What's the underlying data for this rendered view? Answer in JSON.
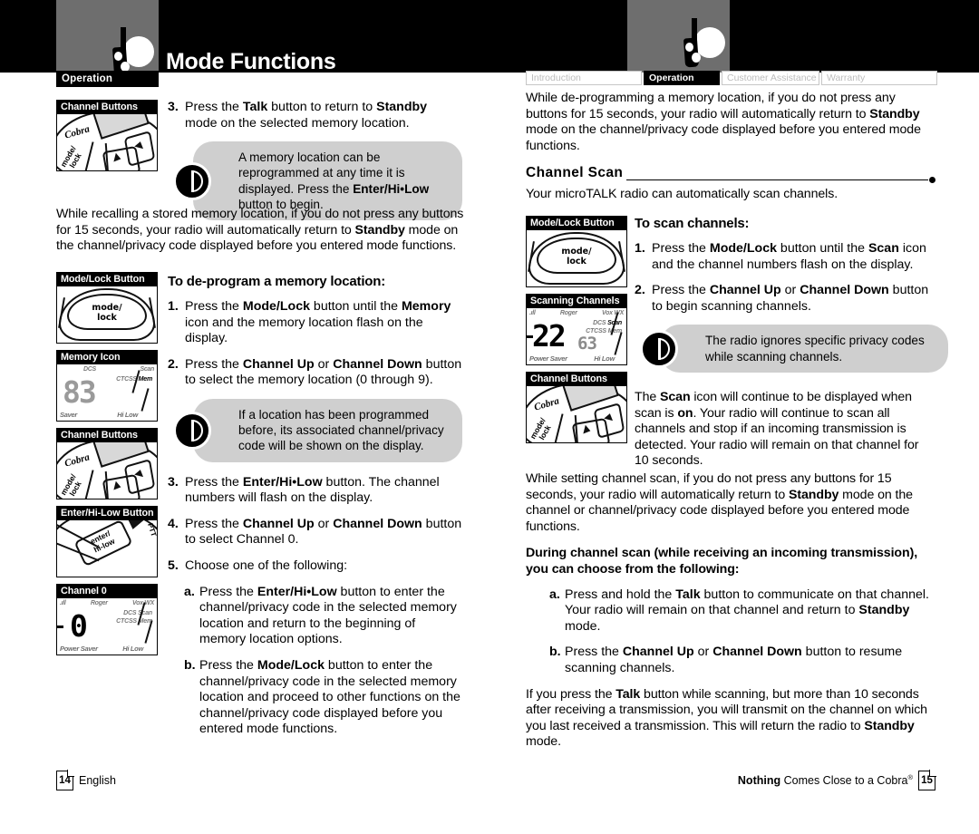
{
  "header": {
    "title": "Mode Functions",
    "section_tab": "Operation",
    "tabs": [
      {
        "label": "Introduction",
        "active": false
      },
      {
        "label": "Operation",
        "active": true
      },
      {
        "label": "Customer Assistance",
        "active": false
      },
      {
        "label": "Warranty",
        "active": false
      }
    ],
    "icon": "radio-walkie-talkie-icon"
  },
  "left_page": {
    "step3": {
      "marker": "3.",
      "text_parts": [
        "Press the ",
        "Talk",
        " button to return to ",
        "Standby",
        " mode on the selected memory location."
      ]
    },
    "tip1": {
      "icon": "info-tip-icon",
      "text_parts": [
        "A memory location can be reprogrammed at any time it is displayed. Press the ",
        "Enter/Hi•Low",
        " button to begin."
      ]
    },
    "paragraph1_parts": [
      "While recalling a stored memory location, if you do not press any buttons for 15 seconds, your radio will automatically return to ",
      "Standby",
      " mode on the channel/privacy code displayed before you entered mode functions."
    ],
    "heading": "To de-program a memory location:",
    "step1": {
      "marker": "1.",
      "parts": [
        "Press the ",
        "Mode/Lock",
        " button until the ",
        "Memory",
        " icon and the memory location flash on the display."
      ]
    },
    "step2": {
      "marker": "2.",
      "parts": [
        "Press the ",
        "Channel Up",
        " or ",
        "Channel Down",
        " button to select the memory location (0 through 9)."
      ]
    },
    "tip2": {
      "icon": "info-tip-icon",
      "text": "If a location has been programmed before, its associated channel/privacy code will be shown on the display."
    },
    "step3b": {
      "marker": "3.",
      "parts": [
        "Press the ",
        "Enter/Hi•Low",
        " button. The channel numbers will flash on the display."
      ]
    },
    "step4": {
      "marker": "4.",
      "parts": [
        "Press the ",
        "Channel Up",
        " or ",
        "Channel Down",
        " button to select Channel 0."
      ]
    },
    "step5": {
      "marker": "5.",
      "text": "Choose one of the following:"
    },
    "step5a": {
      "marker": "a.",
      "parts": [
        "Press the ",
        "Enter/Hi•Low",
        " button to enter the channel/privacy code in the selected memory location and return to the beginning of memory location options."
      ]
    },
    "step5b": {
      "marker": "b.",
      "parts": [
        "Press the ",
        "Mode/Lock",
        " button to enter the channel/privacy code in the selected memory location and proceed to other functions on the channel/privacy code displayed before you entered mode functions."
      ]
    },
    "figures": [
      {
        "caption": "Channel Buttons",
        "art": "keypad"
      },
      {
        "caption": "Mode/Lock Button",
        "art": "modelock"
      },
      {
        "caption": "Memory Icon",
        "art": "lcd-memory"
      },
      {
        "caption": "Channel Buttons",
        "art": "keypad"
      },
      {
        "caption": "Enter/Hi-Low Button",
        "art": "enter"
      },
      {
        "caption": "Channel 0",
        "art": "lcd-channel0"
      }
    ],
    "lcd_memory": {
      "top_labels": [
        "DCS",
        "Scan"
      ],
      "mid_labels": [
        "CTCSS",
        "Mem"
      ],
      "big_value": "83",
      "bottom_labels": [
        "Saver",
        "Hi Low"
      ]
    },
    "lcd_channel0": {
      "top_labels": [
        ".ıll",
        "Roger",
        "Vox WX"
      ],
      "mid_labels": [
        "DCS",
        "Scan",
        "CTCSS",
        "Mem"
      ],
      "big_value": "0",
      "bottom_labels": [
        "Power Saver",
        "Hi Low"
      ]
    }
  },
  "right_page": {
    "paragraph1_parts": [
      "While de-programming a memory location, if you do not press any buttons for 15 seconds, your radio will automatically return to ",
      "Standby",
      " mode on the channel/privacy code displayed before you entered mode functions."
    ],
    "section_title": "Channel Scan",
    "section_intro": "Your microTALK radio can automatically scan channels.",
    "heading": "To scan channels:",
    "step1": {
      "marker": "1.",
      "parts": [
        "Press the ",
        "Mode/Lock",
        " button until the ",
        "Scan",
        " icon and the channel numbers flash on the display."
      ]
    },
    "step2": {
      "marker": "2.",
      "parts": [
        "Press the ",
        "Channel Up",
        " or ",
        "Channel Down",
        " button to begin scanning channels."
      ]
    },
    "tip1": {
      "icon": "info-tip-icon",
      "text": "The radio ignores specific privacy codes while scanning channels."
    },
    "paragraph2_parts": [
      "The ",
      "Scan",
      " icon will continue to be displayed when scan is ",
      "on",
      ". Your radio will continue to scan all channels and stop if an incoming transmission is detected. Your radio will remain on that channel for 10 seconds."
    ],
    "paragraph3_parts": [
      "While setting channel scan, if you do not press any buttons for 15 seconds, your radio will automatically return to ",
      "Standby",
      " mode on the channel or channel/privacy code displayed before you entered mode functions."
    ],
    "heading2": "During channel scan (while receiving an incoming transmission), you can choose from the following:",
    "stepA": {
      "marker": "a.",
      "parts": [
        "Press and hold the ",
        "Talk",
        " button to communicate on that channel. Your radio will remain on that channel and return to ",
        "Standby",
        " mode."
      ]
    },
    "stepB": {
      "marker": "b.",
      "parts": [
        "Press the ",
        "Channel Up",
        " or ",
        "Channel Down",
        " button to resume scanning channels."
      ]
    },
    "paragraph4_parts": [
      "If you press the ",
      "Talk",
      " button while scanning, but more than 10 seconds after receiving a transmission, you will transmit on the channel on which you last received a transmission. This will return the radio to ",
      "Standby",
      " mode."
    ],
    "figures": [
      {
        "caption": "Mode/Lock Button",
        "art": "modelock"
      },
      {
        "caption": "Scanning Channels",
        "art": "lcd-scan"
      },
      {
        "caption": "Channel Buttons",
        "art": "keypad"
      }
    ],
    "lcd_scan": {
      "top_labels": [
        ".ıll",
        "Roger",
        "Vox WX"
      ],
      "mid_labels": [
        "DCS",
        "Scan",
        "CTCSS",
        "Mem"
      ],
      "big_value": "22",
      "sub_value": "63",
      "bottom_labels": [
        "Power Saver",
        "Hi Low"
      ]
    }
  },
  "footer": {
    "left_page_number": "14",
    "left_language": "English",
    "right_tagline_bold": "Nothing",
    "right_tagline_rest": " Comes Close to a Cobra",
    "right_tagline_mark": "®",
    "right_page_number": "15"
  },
  "colors": {
    "black": "#000000",
    "header_gray": "#6e6e6e",
    "tip_gray": "#cfcfcf",
    "tab_inactive_text": "#bdbdbd"
  }
}
